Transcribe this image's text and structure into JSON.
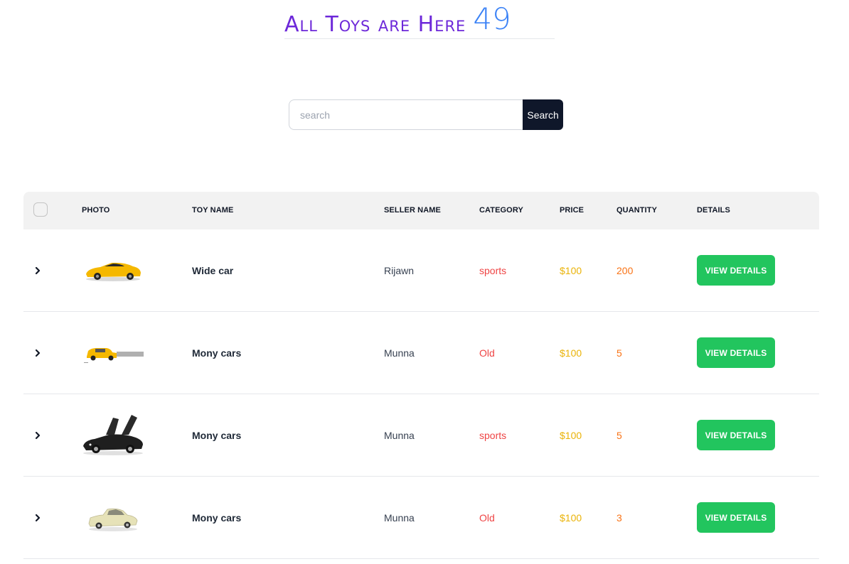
{
  "header": {
    "title": "All Toys are Here",
    "count": "49"
  },
  "search": {
    "placeholder": "search",
    "value": "",
    "button_label": "Search"
  },
  "table": {
    "columns": [
      "PHOTO",
      "TOY NAME",
      "SELLER NAME",
      "CATEGORY",
      "PRICE",
      "QUANTITY",
      "DETAILS"
    ],
    "rows": [
      {
        "toy_name": "Wide car",
        "seller": "Rijawn",
        "category": "sports",
        "price": "$100",
        "quantity": "200",
        "details_label": "VIEW DETAILS",
        "photo": "yellow-sports-car"
      },
      {
        "toy_name": "Mony cars",
        "seller": "Munna",
        "category": "Old",
        "price": "$100",
        "quantity": "5",
        "details_label": "VIEW DETAILS",
        "photo": "yellow-small-car"
      },
      {
        "toy_name": "Mony cars",
        "seller": "Munna",
        "category": "sports",
        "price": "$100",
        "quantity": "5",
        "details_label": "VIEW DETAILS",
        "photo": "black-supercar-open-doors"
      },
      {
        "toy_name": "Mony cars",
        "seller": "Munna",
        "category": "Old",
        "price": "$100",
        "quantity": "3",
        "details_label": "VIEW DETAILS",
        "photo": "beige-vintage-car"
      }
    ]
  },
  "colors": {
    "title": "#6d28d9",
    "count": "#3b82f6",
    "search_button": "#0f172a",
    "category": "#ef4444",
    "price": "#eab308",
    "quantity": "#f97316",
    "details_button": "#22c55e"
  }
}
